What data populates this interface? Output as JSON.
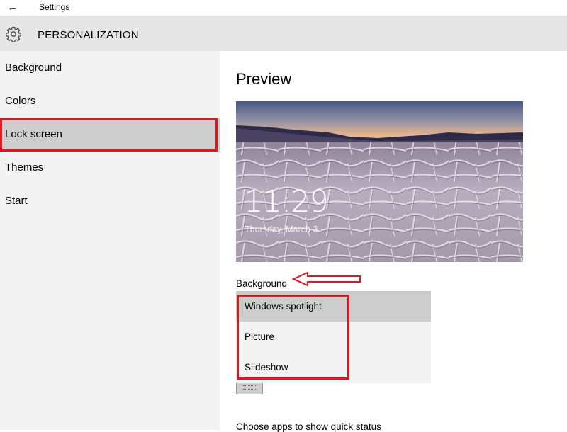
{
  "window": {
    "title": "Settings",
    "back_icon": "back-arrow-icon"
  },
  "header": {
    "icon": "gear-icon",
    "title": "PERSONALIZATION"
  },
  "sidebar": {
    "items": [
      {
        "label": "Background",
        "selected": false
      },
      {
        "label": "Colors",
        "selected": false
      },
      {
        "label": "Lock screen",
        "selected": true
      },
      {
        "label": "Themes",
        "selected": false
      },
      {
        "label": "Start",
        "selected": false
      }
    ]
  },
  "main": {
    "preview_heading": "Preview",
    "preview": {
      "time": "11:29",
      "date": "Thursday, March 3"
    },
    "background_label": "Background",
    "background_options": [
      {
        "label": "Windows spotlight",
        "selected": true
      },
      {
        "label": "Picture",
        "selected": false
      },
      {
        "label": "Slideshow",
        "selected": false
      }
    ],
    "quick_status_label": "Choose apps to show quick status"
  },
  "annotations": {
    "highlight_color": "#e3141c"
  },
  "colors": {
    "header_bg": "#e6e6e6",
    "sidebar_bg": "#f2f2f2",
    "selected_bg": "#cdcdcd"
  }
}
